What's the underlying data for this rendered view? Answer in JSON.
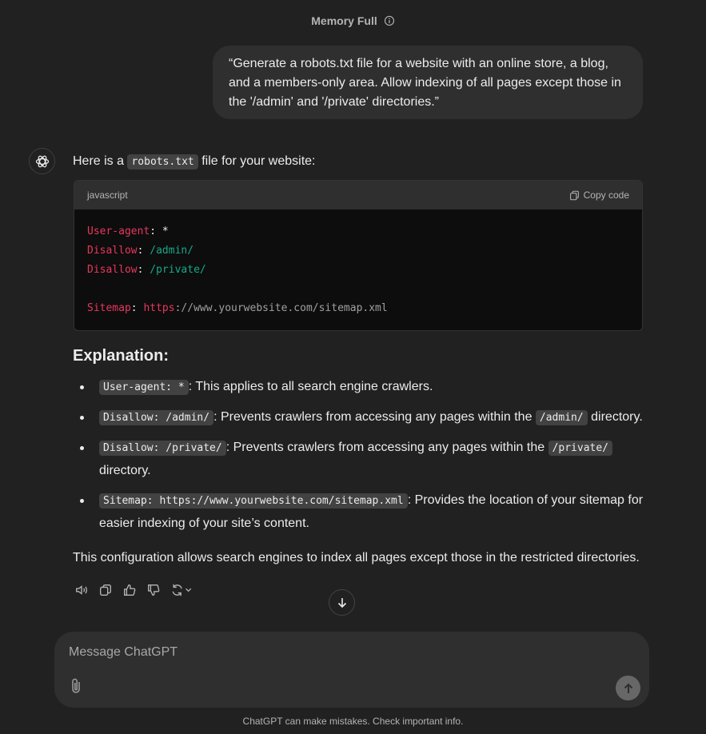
{
  "header": {
    "title": "Memory Full",
    "info_icon": "info-icon"
  },
  "user_message": "“Generate a robots.txt file for a website with an online store, a blog, and a members-only area. Allow indexing of all pages except those in the '/admin' and '/private' directories.”",
  "assistant": {
    "avatar_icon": "openai-logo-icon",
    "intro_before": "Here is a ",
    "intro_code": "robots.txt",
    "intro_after": " file for your website:",
    "codeblock": {
      "language": "javascript",
      "copy_label": "Copy code",
      "lines": {
        "l1_key": "User-agent",
        "l1_rest": ": *",
        "l2_key": "Disallow",
        "l2_sep": ": ",
        "l2_val": "/admin/",
        "l3_key": "Disallow",
        "l3_sep": ": ",
        "l3_val": "/private/",
        "l4_key": "Sitemap",
        "l4_sep": ": ",
        "l4_scheme": "https",
        "l4_rest": "://www.yourwebsite.com/sitemap.xml"
      }
    },
    "explanation_heading": "Explanation:",
    "bullets": [
      {
        "code": "User-agent: *",
        "text": ": This applies to all search engine crawlers."
      },
      {
        "code": "Disallow: /admin/",
        "text": ": Prevents crawlers from accessing any pages within the ",
        "code2": "/admin/",
        "text2": " directory."
      },
      {
        "code": "Disallow: /private/",
        "text": ": Prevents crawlers from accessing any pages within the ",
        "code2": "/private/",
        "text2": " directory."
      },
      {
        "code": "Sitemap: https://www.yourwebsite.com/sitemap.xml",
        "text": ": Provides the location of your sitemap for easier indexing of your site’s content."
      }
    ],
    "summary": "This configuration allows search engines to index all pages except those in the restricted directories.",
    "actions": [
      "read-aloud-icon",
      "copy-icon",
      "thumbs-up-icon",
      "thumbs-down-icon",
      "regenerate-icon"
    ]
  },
  "composer": {
    "placeholder": "Message ChatGPT"
  },
  "footer": "ChatGPT can make mistakes. Check important info."
}
